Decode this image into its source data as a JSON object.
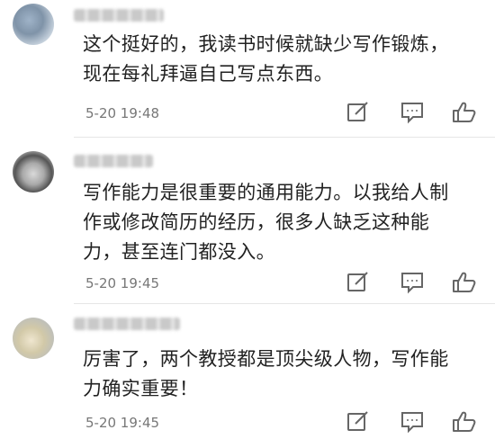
{
  "comments": [
    {
      "text_line1": "这个挺好的，我读书时候就缺少写作锻炼，",
      "text_line2": "现在每礼拜逼自己写点东西。",
      "time": "5-20 19:48"
    },
    {
      "text_line1": "写作能力是很重要的通用能力。以我给人制",
      "text_line2": "作或修改简历的经历，很多人缺乏这种能",
      "text_line3": "力，甚至连门都没入。",
      "time": "5-20 19:45"
    },
    {
      "text_line1": "厉害了，两个教授都是顶尖级人物，写作能",
      "text_line2": "力确实重要！",
      "time": "5-20 19:45"
    }
  ],
  "icons": {
    "edit": "edit-icon",
    "comment": "comment-icon",
    "like": "thumbs-up-icon"
  },
  "colors": {
    "text": "#222222",
    "time": "#777777",
    "icon": "#666666",
    "divider": "#e6e6e6"
  }
}
